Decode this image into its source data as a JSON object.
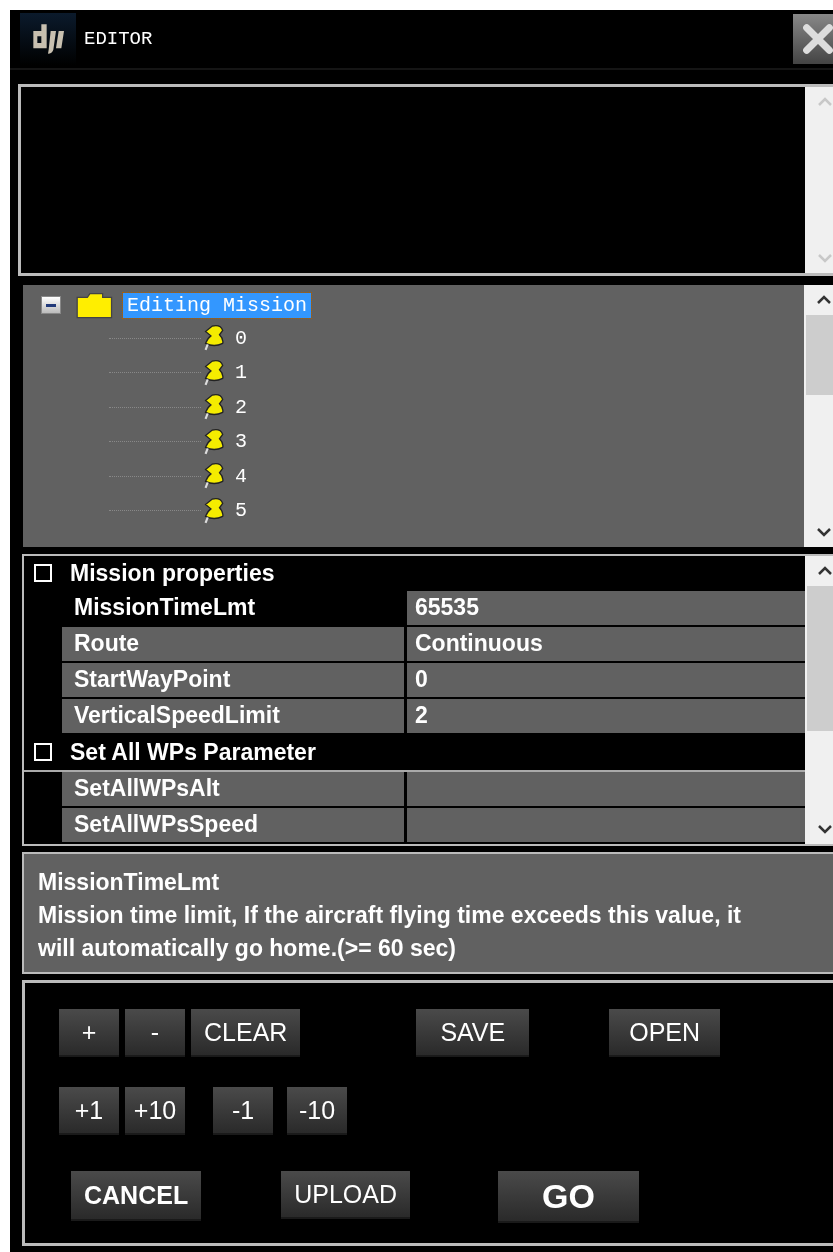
{
  "window": {
    "title": "EDITOR"
  },
  "tree": {
    "label": "Editing Mission",
    "expanded": true,
    "selected": true,
    "children": [
      {
        "label": "0",
        "selected": false
      },
      {
        "label": "1",
        "selected": false
      },
      {
        "label": "2",
        "selected": false
      },
      {
        "label": "3",
        "selected": false
      },
      {
        "label": "4",
        "selected": false
      },
      {
        "label": "5",
        "selected": false
      }
    ]
  },
  "properties": [
    {
      "category": "Mission properties",
      "rows": [
        {
          "name": "MissionTimeLmt",
          "value": "65535",
          "selected": true
        },
        {
          "name": "Route",
          "value": "Continuous",
          "selected": false
        },
        {
          "name": "StartWayPoint",
          "value": "0",
          "selected": false
        },
        {
          "name": "VerticalSpeedLimit",
          "value": "2",
          "selected": false
        }
      ]
    },
    {
      "category": "Set All WPs Parameter",
      "rows": [
        {
          "name": "SetAllWPsAlt",
          "selected": false
        },
        {
          "name": "SetAllWPsSpeed",
          "selected": false
        }
      ]
    }
  ],
  "description": {
    "title": "MissionTimeLmt",
    "text": "Mission time limit, If the aircraft flying time exceeds this value, it will automatically go home.(>= 60 sec)"
  },
  "button_rows": [
    [
      {
        "label": "+",
        "kind": "small"
      },
      {
        "label": "-",
        "kind": "small"
      },
      {
        "label": "CLEAR",
        "kind": "normal"
      },
      {
        "label": "SAVE",
        "kind": "normal"
      },
      {
        "label": "OPEN",
        "kind": "normal"
      }
    ],
    [
      {
        "label": "+1",
        "kind": "small"
      },
      {
        "label": "+10",
        "kind": "small"
      },
      {
        "label": "-1",
        "kind": "small"
      },
      {
        "label": "-10",
        "kind": "small"
      }
    ],
    [
      {
        "label": "CANCEL",
        "kind": "bold"
      },
      {
        "label": "UPLOAD",
        "kind": "normal"
      },
      {
        "label": "GO",
        "kind": "primary"
      }
    ]
  ]
}
